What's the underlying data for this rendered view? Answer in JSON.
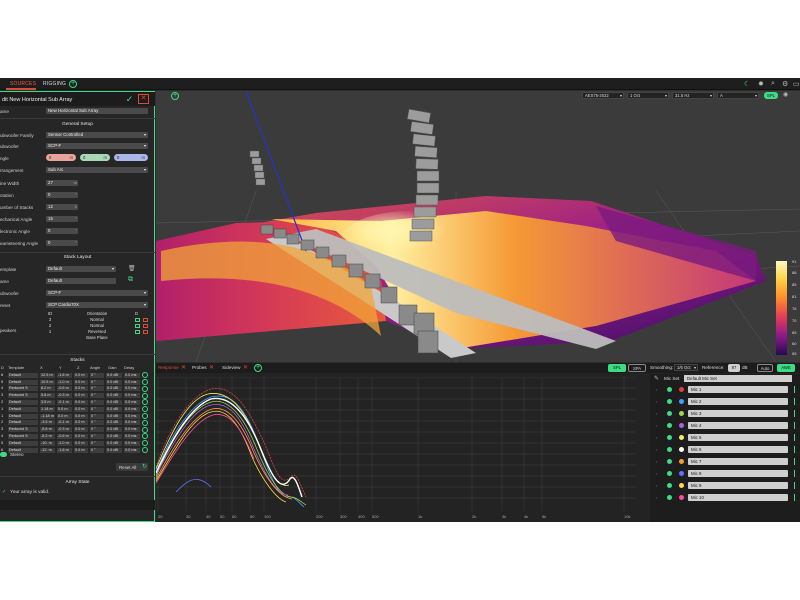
{
  "topbar": {
    "tabs": [
      "SOURCES",
      "RIGGING"
    ],
    "active_tab": "SOURCES"
  },
  "left_panel": {
    "title": "dit New Horizontal Sub Array",
    "name_label": "ame",
    "name_value": "New Horizontal Sub Array",
    "general_setup": {
      "heading": "General Setup",
      "family_label": "ubwoofer Family",
      "family_value": "Sensor Controlled",
      "sub_label": "ubwoofer",
      "sub_value": "SCP-F",
      "angle_label": "ngle",
      "angle_values": [
        "0",
        "0",
        "0"
      ],
      "angle_unit": "m",
      "arrangement_label": "rrangement",
      "arrangement_value": "Sub Arc",
      "fields": [
        {
          "label": "ine Width",
          "value": "27",
          "unit": "m"
        },
        {
          "label": "otation",
          "value": "0",
          "unit": "°"
        },
        {
          "label": "umber of Stacks",
          "value": "12",
          "unit": "X"
        },
        {
          "label": "echanical Angle",
          "value": "15",
          "unit": "°"
        },
        {
          "label": "lectronic Angle",
          "value": "0",
          "unit": "°"
        },
        {
          "label": "eamsteering Angle",
          "value": "0",
          "unit": "°"
        }
      ]
    },
    "stack_layout": {
      "heading": "Stack Layout",
      "template_label": "emplate",
      "template_value": "Default",
      "name_label": "ame",
      "name_value": "Default",
      "sub_label": "ubwoofer",
      "sub_value": "SCP-F",
      "preset_label": "reset",
      "preset_value": "SCP Cardio70X",
      "speakers_label": "peakers",
      "orientation_header": {
        "id": "ID",
        "orientation": "Orientation"
      },
      "orientation_rows": [
        {
          "id": "3",
          "name": "Normal"
        },
        {
          "id": "2",
          "name": "Normal"
        },
        {
          "id": "1",
          "name": "Reversed"
        }
      ],
      "base_plane": "Base Plane"
    },
    "stacks": {
      "heading": "Stacks",
      "columns": [
        "D",
        "Template",
        "X",
        "Y",
        "Z",
        "Angle",
        "Gain",
        "Delay"
      ],
      "rows": [
        [
          "6",
          "Default",
          "12.5",
          "-1.6",
          "0.0",
          "0",
          "0.0",
          "0.0"
        ],
        [
          "5",
          "Default",
          "10.5",
          "-1.0",
          "0.0",
          "0",
          "0.0",
          "0.0"
        ],
        [
          "4",
          "Reduced S",
          "8.2",
          "-0.6",
          "0.0",
          "0",
          "0.0",
          "0.0"
        ],
        [
          "3",
          "Reduced S",
          "5.8",
          "-0.3",
          "0.0",
          "0",
          "0.0",
          "0.0"
        ],
        [
          "2",
          "Default",
          "3.5",
          "-0.1",
          "0.0",
          "0",
          "0.0",
          "0.0"
        ],
        [
          "1",
          "Default",
          "1.18",
          "0.0",
          "0.0",
          "0",
          "0.0",
          "0.0"
        ],
        [
          "1",
          "Default",
          "-1.18",
          "0.0",
          "0.0",
          "0",
          "0.0",
          "0.0"
        ],
        [
          "2",
          "Default",
          "-3.5",
          "-0.1",
          "0.0",
          "0",
          "0.0",
          "0.0"
        ],
        [
          "3",
          "Reduced S",
          "-5.8",
          "-0.3",
          "0.0",
          "0",
          "0.0",
          "0.0"
        ],
        [
          "4",
          "Reduced S",
          "-8.2",
          "-0.6",
          "0.0",
          "0",
          "0.0",
          "0.0"
        ],
        [
          "5",
          "Default",
          "-10.",
          "-1.0",
          "0.0",
          "0",
          "0.0",
          "0.0"
        ],
        [
          "6",
          "Default",
          "-12.",
          "-1.6",
          "0.0",
          "0",
          "0.0",
          "0.0"
        ]
      ],
      "units": {
        "x": "m",
        "y": "m",
        "z": "m",
        "angle": "°",
        "gain": "dB",
        "delay": "ms"
      }
    },
    "stereo_label": "Stereo",
    "reset_all_label": "Reset All",
    "array_state_heading": "Array State",
    "valid_message": "Your array is valid."
  },
  "viewport": {
    "standard": "AES75-2022",
    "band": "1 Oct",
    "frequency": "31.5 Hz",
    "weighting": "A",
    "spl_button": "SPL",
    "colorbar_ticks": [
      "91",
      "88",
      "85",
      "81",
      "76",
      "70",
      "65",
      "60",
      "55"
    ]
  },
  "lower": {
    "tabs": [
      "Response",
      "Probes",
      "Sideview"
    ],
    "spl_chip": "SPL",
    "spa_chip": "SPA",
    "smoothing_label": "Smoothing:",
    "smoothing_value": "1/6 Oct",
    "reference_label": "Reference:",
    "reference_value": "97",
    "reference_unit": "dB",
    "auto_label": "Auto",
    "awe_label": "AWE",
    "mic_set_label": "Mic Set",
    "mic_set_value": "Default Mic Set",
    "x_ticks": [
      "20",
      "30",
      "40",
      "50",
      "60",
      "80",
      "100",
      "200",
      "300",
      "400",
      "500",
      "1k",
      "2k",
      "3k",
      "4k",
      "5k",
      "10k"
    ],
    "mics": [
      {
        "label": "Mic 1",
        "color": "#e04040"
      },
      {
        "label": "Mic 2",
        "color": "#40a0ff"
      },
      {
        "label": "Mic 3",
        "color": "#9ad94a"
      },
      {
        "label": "Mic 4",
        "color": "#b060e0"
      },
      {
        "label": "Mic 5",
        "color": "#f0f060"
      },
      {
        "label": "Mic 6",
        "color": "#ffffff"
      },
      {
        "label": "Mic 7",
        "color": "#ff9a30"
      },
      {
        "label": "Mic 8",
        "color": "#6070ff"
      },
      {
        "label": "Mic 9",
        "color": "#ffd84a"
      },
      {
        "label": "Mic 10",
        "color": "#ff4aa0"
      }
    ]
  }
}
